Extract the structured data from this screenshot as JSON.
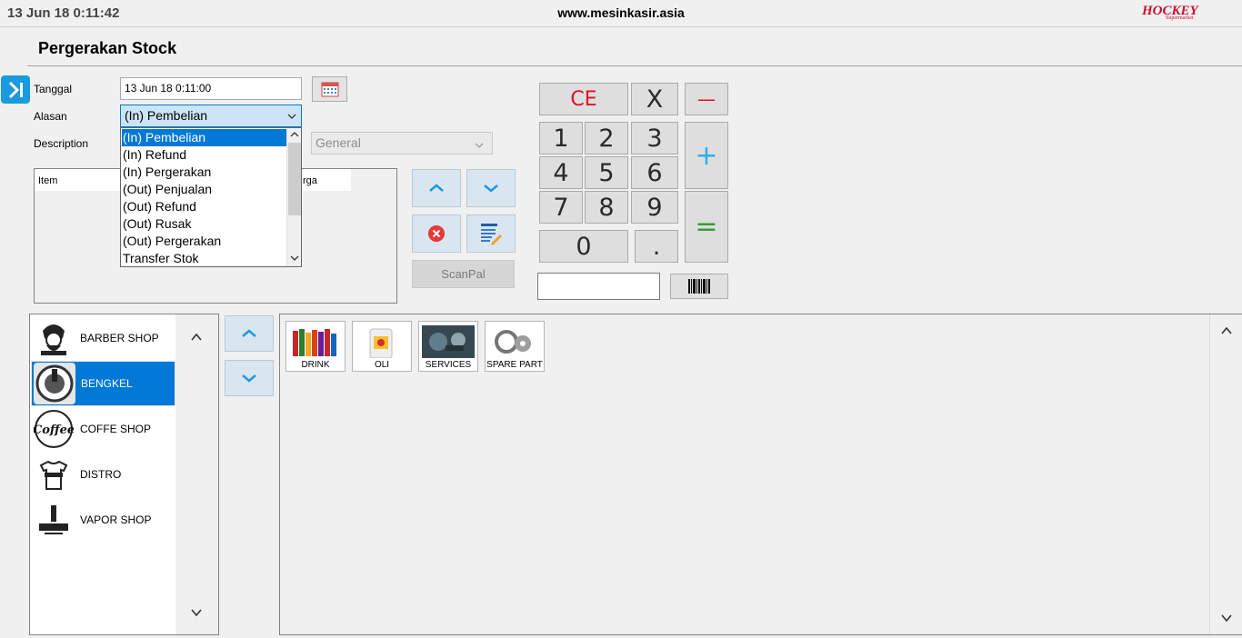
{
  "header": {
    "datetime": "13 Jun 18  0:11:42",
    "site": "www.mesinkasir.asia",
    "brand": "HOCKEY",
    "brand_sub": "Supermarket"
  },
  "page_title": "Pergerakan Stock",
  "form": {
    "date_label": "Tanggal",
    "date_value": "13 Jun 18 0:11:00",
    "reason_label": "Alasan",
    "reason_value": "(In) Pembelian",
    "description_label": "Description",
    "group_value": "General",
    "reason_options": [
      "(In) Pembelian",
      "(In) Refund",
      "(In) Pergerakan",
      "(Out) Penjualan",
      "(Out) Refund",
      "(Out) Rusak",
      "(Out) Pergerakan",
      "Transfer Stok"
    ]
  },
  "grid": {
    "col_item": "Item",
    "col_harga": "rga"
  },
  "buttons": {
    "scanpal": "ScanPal"
  },
  "keypad": {
    "ce": "CE",
    "x": "X",
    "minus": "—",
    "plus": "+",
    "equals": "=",
    "k1": "1",
    "k2": "2",
    "k3": "3",
    "k4": "4",
    "k5": "5",
    "k6": "6",
    "k7": "7",
    "k8": "8",
    "k9": "9",
    "k0": "0",
    "dot": "."
  },
  "categories": [
    {
      "label": "BARBER SHOP",
      "icon": "barber-logo"
    },
    {
      "label": "BENGKEL",
      "icon": "bengkel-logo",
      "selected": true
    },
    {
      "label": "COFFE SHOP",
      "icon": "coffee-logo"
    },
    {
      "label": "DISTRO",
      "icon": "distro-logo"
    },
    {
      "label": "VAPOR SHOP",
      "icon": "vapor-logo"
    }
  ],
  "products": [
    {
      "label": "DRINK",
      "icon": "drink-image"
    },
    {
      "label": "OLI",
      "icon": "oil-image"
    },
    {
      "label": "SERVICES",
      "icon": "services-image"
    },
    {
      "label": "SPARE PART",
      "icon": "spare-part-image"
    }
  ],
  "colors": {
    "accent": "#0078d7",
    "toggle": "#1b9ae0",
    "ce": "#e0102a",
    "plus": "#2ab0e6",
    "equals": "#3a9a3a",
    "brand": "#c8102e"
  }
}
